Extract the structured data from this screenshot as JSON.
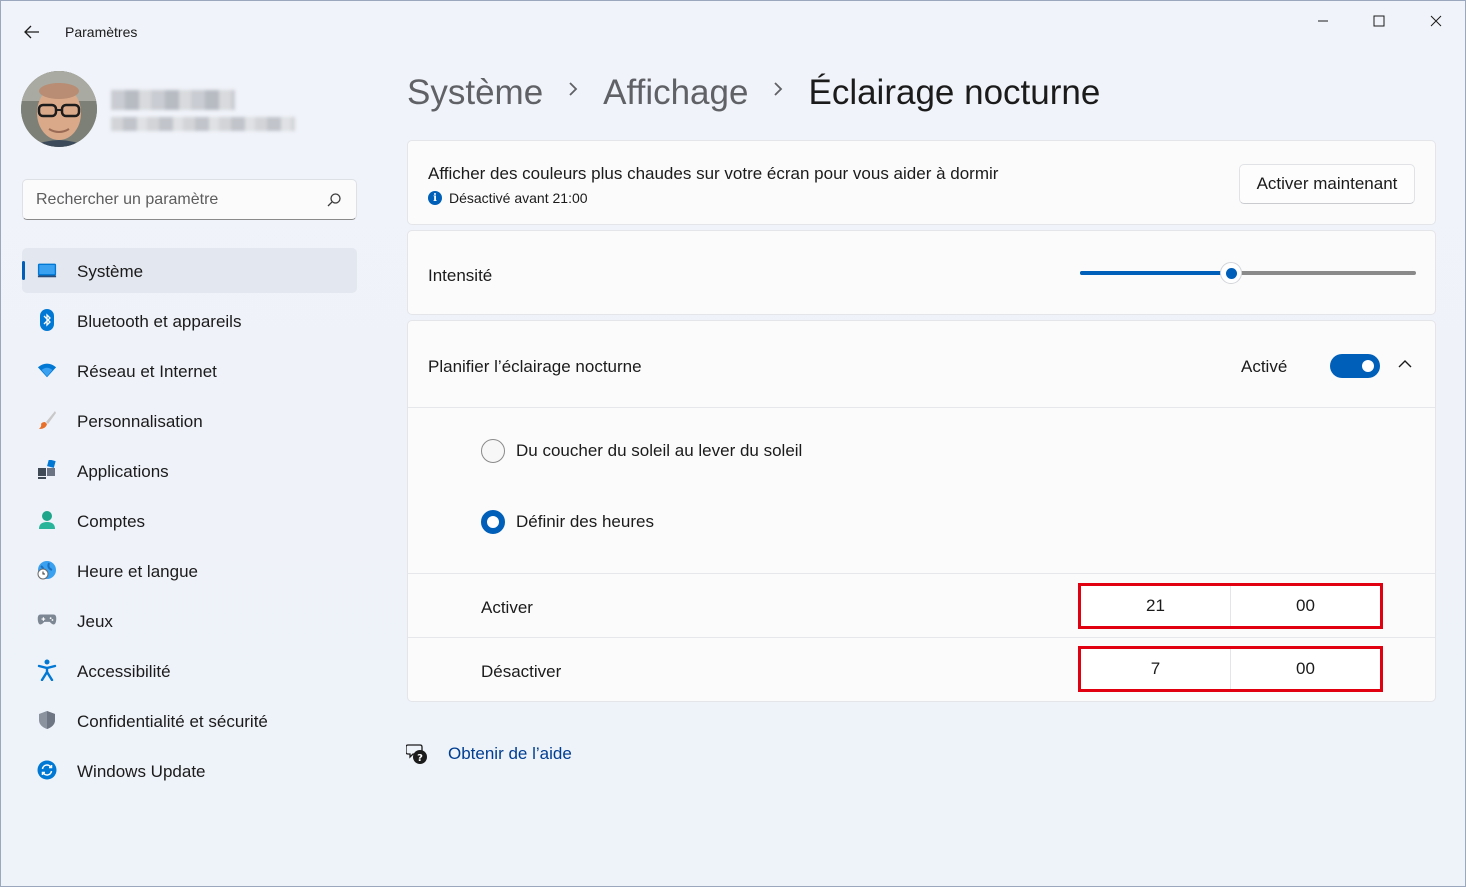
{
  "window": {
    "title": "Paramètres"
  },
  "search": {
    "placeholder": "Rechercher un paramètre"
  },
  "sidebar": {
    "items": [
      {
        "label": "Système",
        "icon": "monitor-icon",
        "active": true
      },
      {
        "label": "Bluetooth et appareils",
        "icon": "bluetooth-icon"
      },
      {
        "label": "Réseau et Internet",
        "icon": "wifi-icon"
      },
      {
        "label": "Personnalisation",
        "icon": "paintbrush-icon"
      },
      {
        "label": "Applications",
        "icon": "apps-icon"
      },
      {
        "label": "Comptes",
        "icon": "person-icon"
      },
      {
        "label": "Heure et langue",
        "icon": "globe-clock-icon"
      },
      {
        "label": "Jeux",
        "icon": "gamepad-icon"
      },
      {
        "label": "Accessibilité",
        "icon": "accessibility-icon"
      },
      {
        "label": "Confidentialité et sécurité",
        "icon": "shield-icon"
      },
      {
        "label": "Windows Update",
        "icon": "update-icon"
      }
    ]
  },
  "breadcrumb": {
    "items": [
      "Système",
      "Affichage",
      "Éclairage nocturne"
    ]
  },
  "night_light": {
    "description": "Afficher des couleurs plus chaudes sur votre écran pour vous aider à dormir",
    "status": "Désactivé avant 21:00",
    "activate_button": "Activer maintenant"
  },
  "intensity": {
    "label": "Intensité",
    "value_fraction": 0.45
  },
  "schedule": {
    "label": "Planifier l’éclairage nocturne",
    "state": "Activé",
    "enabled": true,
    "options": [
      {
        "label": "Du coucher du soleil au lever du soleil",
        "checked": false
      },
      {
        "label": "Définir des heures",
        "checked": true
      }
    ],
    "on_time": {
      "label": "Activer",
      "hour": "21",
      "minute": "00"
    },
    "off_time": {
      "label": "Désactiver",
      "hour": "7",
      "minute": "00"
    }
  },
  "help": {
    "label": "Obtenir de l’aide"
  },
  "colors": {
    "accent": "#005fb8",
    "highlight_border": "#e0000f",
    "background": "#eef2f9",
    "card": "#fbfbfc"
  }
}
